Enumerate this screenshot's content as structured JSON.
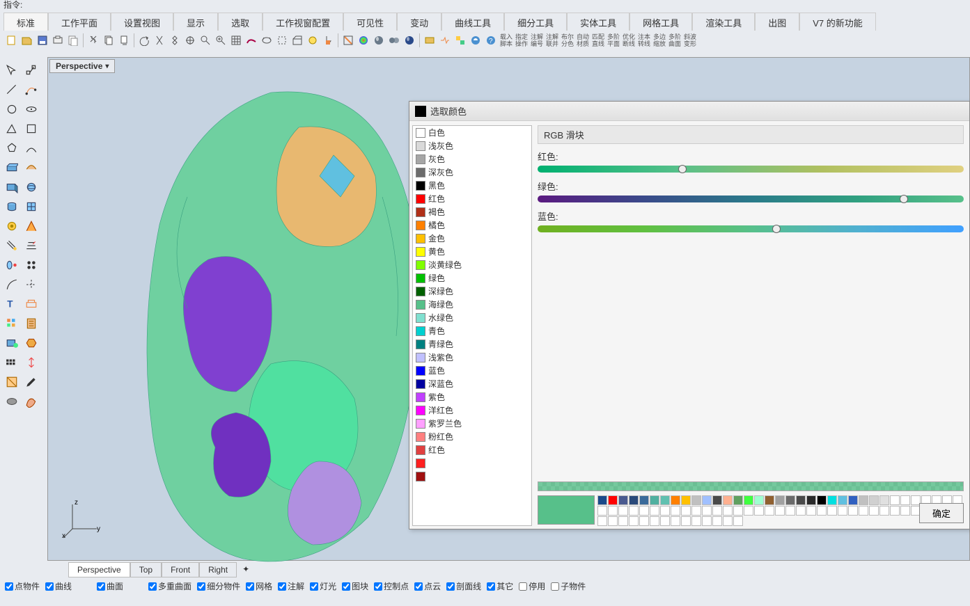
{
  "top_label": "指令:",
  "tabs": [
    "标准",
    "工作平面",
    "设置视图",
    "显示",
    "选取",
    "工作视窗配置",
    "可见性",
    "变动",
    "曲线工具",
    "细分工具",
    "实体工具",
    "网格工具",
    "渲染工具",
    "出图",
    "V7 的新功能"
  ],
  "active_tab_index": 0,
  "toolbar_text_icons": [
    "载入脚本",
    "指定操作",
    "注解编号",
    "注解联并",
    "布尔分色",
    "自动材质",
    "匹配直线",
    "多阶平面",
    "优化断线",
    "注本转线",
    "多边缩放",
    "多阶曲面",
    "斜波变形"
  ],
  "viewport": {
    "title": "Perspective",
    "axes": [
      "x",
      "y",
      "z"
    ]
  },
  "viewport_tabs": [
    "Perspective",
    "Top",
    "Front",
    "Right"
  ],
  "active_vtab_index": 0,
  "status_checks": [
    {
      "label": "点物件",
      "checked": true
    },
    {
      "label": "曲线",
      "checked": true
    },
    {
      "label": "曲面",
      "checked": true
    },
    {
      "label": "多重曲面",
      "checked": true
    },
    {
      "label": "细分物件",
      "checked": true
    },
    {
      "label": "网格",
      "checked": true
    },
    {
      "label": "注解",
      "checked": true
    },
    {
      "label": "灯光",
      "checked": true
    },
    {
      "label": "图块",
      "checked": true
    },
    {
      "label": "控制点",
      "checked": true
    },
    {
      "label": "点云",
      "checked": true
    },
    {
      "label": "剖面线",
      "checked": true
    },
    {
      "label": "其它",
      "checked": true
    },
    {
      "label": "停用",
      "checked": false
    },
    {
      "label": "子物件",
      "checked": false
    }
  ],
  "dialog": {
    "title": "选取颜色",
    "rgb_header": "RGB 滑块",
    "sliders": {
      "red": {
        "label": "红色:",
        "value": 87,
        "gradient": "linear-gradient(90deg,#00b070,#57c08a,#b0c060,#e0d080)",
        "handle_pct": 34
      },
      "green": {
        "label": "绿色:",
        "value": 192,
        "gradient": "linear-gradient(90deg,#5a1a80,#3a4a8a,#2a7a8a,#30a080,#57c08a)",
        "handle_pct": 86
      },
      "blue": {
        "label": "蓝色:",
        "value": 138,
        "gradient": "linear-gradient(90deg,#70b020,#60c040,#57c08a,#50b0d0,#40a0ff)",
        "handle_pct": 56
      }
    },
    "colors": [
      {
        "name": "白色",
        "hex": "#ffffff"
      },
      {
        "name": "浅灰色",
        "hex": "#d9d9d9"
      },
      {
        "name": "灰色",
        "hex": "#a6a6a6"
      },
      {
        "name": "深灰色",
        "hex": "#6b6b6b"
      },
      {
        "name": "黑色",
        "hex": "#000000"
      },
      {
        "name": "红色",
        "hex": "#ff0000"
      },
      {
        "name": "褐色",
        "hex": "#b03018"
      },
      {
        "name": "橘色",
        "hex": "#ff8000"
      },
      {
        "name": "金色",
        "hex": "#ffc000"
      },
      {
        "name": "黄色",
        "hex": "#ffff00"
      },
      {
        "name": "淡黄绿色",
        "hex": "#80ff00"
      },
      {
        "name": "绿色",
        "hex": "#00c000"
      },
      {
        "name": "深绿色",
        "hex": "#006000"
      },
      {
        "name": "海绿色",
        "hex": "#57c08a"
      },
      {
        "name": "水绿色",
        "hex": "#80e0d0"
      },
      {
        "name": "青色",
        "hex": "#00d0d0"
      },
      {
        "name": "青绿色",
        "hex": "#008080"
      },
      {
        "name": "浅紫色",
        "hex": "#c0c0ff"
      },
      {
        "name": "蓝色",
        "hex": "#0000ff"
      },
      {
        "name": "深蓝色",
        "hex": "#0000a0"
      },
      {
        "name": "紫色",
        "hex": "#c040ff"
      },
      {
        "name": "洋红色",
        "hex": "#ff00ff"
      },
      {
        "name": "紫罗兰色",
        "hex": "#ffa0ff"
      },
      {
        "name": "粉红色",
        "hex": "#ff8080"
      },
      {
        "name": "红色",
        "hex": "#e04040"
      },
      {
        "name": "",
        "hex": "#ff2020"
      },
      {
        "name": "",
        "hex": "#a01010"
      }
    ],
    "preview_hex": "#57c08a",
    "palette_row": [
      "#1a4a8a",
      "#ff0000",
      "#4a5a8f",
      "#2a4a7a",
      "#3a6a9a",
      "#50b0a0",
      "#60c0b0",
      "#ff8000",
      "#ffc000",
      "#c0c0c0",
      "#a0c0ff",
      "#4a4a4a",
      "#ffb090",
      "#60a060",
      "#40ff40",
      "#a0ffd0",
      "#906030",
      "#a0a0a0",
      "#6a6a6a",
      "#4a4a4a",
      "#2a2a2a",
      "#000000",
      "#00e0e0",
      "#60c0e0",
      "#3060c0",
      "#c0c0c0",
      "#d0d0d0",
      "#e0e0e0"
    ],
    "ok_label": "确定"
  }
}
